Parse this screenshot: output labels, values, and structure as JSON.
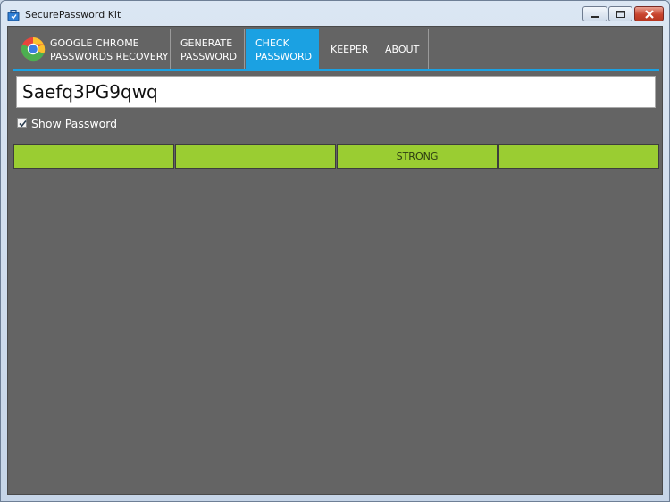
{
  "window": {
    "title": "SecurePassword Kit"
  },
  "tabs": [
    {
      "label": "GOOGLE CHROME\nPASSWORDS RECOVERY",
      "active": false
    },
    {
      "label": "GENERATE\nPASSWORD",
      "active": false
    },
    {
      "label": "CHECK\nPASSWORD",
      "active": true
    },
    {
      "label": "KEEPER",
      "active": false
    },
    {
      "label": "ABOUT",
      "active": false
    }
  ],
  "password": {
    "value": "Saefq3PG9qwq"
  },
  "show_password": {
    "label": "Show Password",
    "checked": true
  },
  "strength": {
    "label": "STRONG",
    "segments_filled": 4,
    "segments_total": 4,
    "color": "#9acd32"
  },
  "colors": {
    "accent": "#1ba1e2",
    "background": "#646464",
    "strength": "#9acd32"
  },
  "icons": [
    "app-icon",
    "chrome-logo-icon",
    "minimize-icon",
    "maximize-icon",
    "close-icon",
    "checkmark-icon"
  ]
}
